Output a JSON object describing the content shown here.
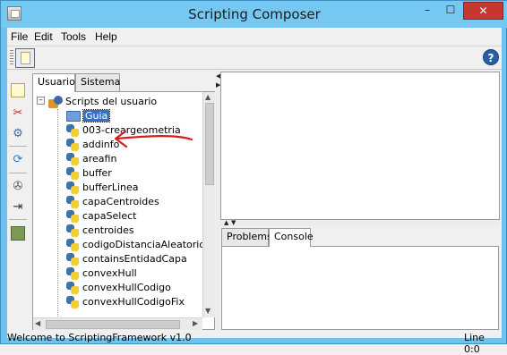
{
  "window": {
    "title": "Scripting Composer",
    "minimize": "–",
    "maximize": "☐",
    "close": "✕"
  },
  "menu": [
    "File",
    "Edit",
    "Tools",
    "Help"
  ],
  "toolbar": {
    "help_glyph": "?"
  },
  "left_tools": [
    "new-script-icon",
    "cut-script-icon",
    "settings-icon",
    "refresh-icon",
    "tools-icon",
    "import-icon",
    "package-icon"
  ],
  "left_tabs": [
    {
      "label": "Usuario",
      "active": true
    },
    {
      "label": "Sistema",
      "active": false
    }
  ],
  "tree": {
    "expander": "–",
    "root_label": "Scripts del usuario",
    "folder_label": "Guia",
    "scripts": [
      "003-creargeometria",
      "addinfo",
      "areafin",
      "buffer",
      "bufferLinea",
      "capaCentroides",
      "capaSelect",
      "centroides",
      "codigoDistanciaAleatorios",
      "containsEntidadCapa",
      "convexHull",
      "convexHullCodigo",
      "convexHullCodigoFix"
    ]
  },
  "right_tabs": [
    {
      "label": "Problems",
      "active": false
    },
    {
      "label": "Console",
      "active": true
    }
  ],
  "status": {
    "message": "Welcome to ScriptingFramework v1.0",
    "position": "Line 0:0"
  },
  "colors": {
    "titlebar": "#75c8f2",
    "selection": "#3271c9",
    "annotation": "#d81b1b",
    "close_button": "#c7362f"
  }
}
